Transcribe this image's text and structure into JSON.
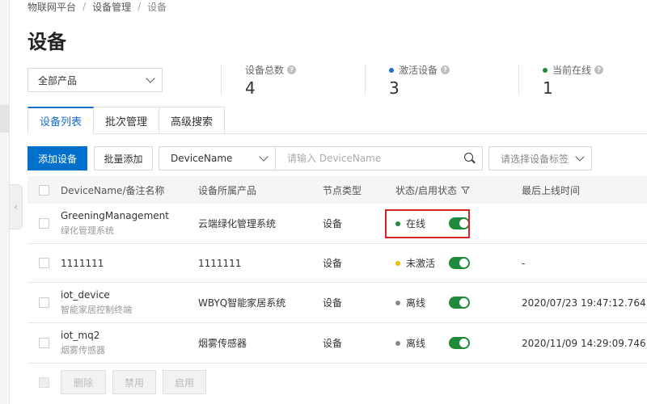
{
  "breadcrumb": [
    "物联网平台",
    "设备管理",
    "设备"
  ],
  "page_title": "设备",
  "product_select": "全部产品",
  "stats": {
    "total": {
      "label": "设备总数",
      "value": "4"
    },
    "activated": {
      "label": "激活设备",
      "value": "3",
      "color": "#1a6fc9"
    },
    "online": {
      "label": "当前在线",
      "value": "1",
      "color": "#1f8a3a"
    }
  },
  "tabs": [
    "设备列表",
    "批次管理",
    "高级搜索"
  ],
  "toolbar": {
    "add_label": "添加设备",
    "batch_add_label": "批量添加",
    "name_select": "DeviceName",
    "search_placeholder": "请输入 DeviceName",
    "tag_placeholder": "请选择设备标签"
  },
  "columns": [
    "DeviceName/备注名称",
    "设备所属产品",
    "节点类型",
    "状态/启用状态",
    "最后上线时间"
  ],
  "rows": [
    {
      "name": "GreeningManagement",
      "note": "绿化管理系统",
      "product": "云端绿化管理系统",
      "type": "设备",
      "status": "在线",
      "status_color": "#1f8a3a",
      "time": ""
    },
    {
      "name": "1111111",
      "note": "",
      "product": "1111111",
      "type": "设备",
      "status": "未激活",
      "status_color": "#f5b800",
      "time": "-"
    },
    {
      "name": "iot_device",
      "note": "智能家居控制终端",
      "product": "WBYQ智能家居系统",
      "type": "设备",
      "status": "离线",
      "status_color": "#888888",
      "time": "2020/07/23 19:47:12.764"
    },
    {
      "name": "iot_mq2",
      "note": "烟雾传感器",
      "product": "烟雾传感器",
      "type": "设备",
      "status": "离线",
      "status_color": "#888888",
      "time": "2020/11/09 14:29:09.746"
    }
  ],
  "footer": {
    "delete_label": "删除",
    "disable_label": "禁用",
    "enable_label": "启用"
  }
}
